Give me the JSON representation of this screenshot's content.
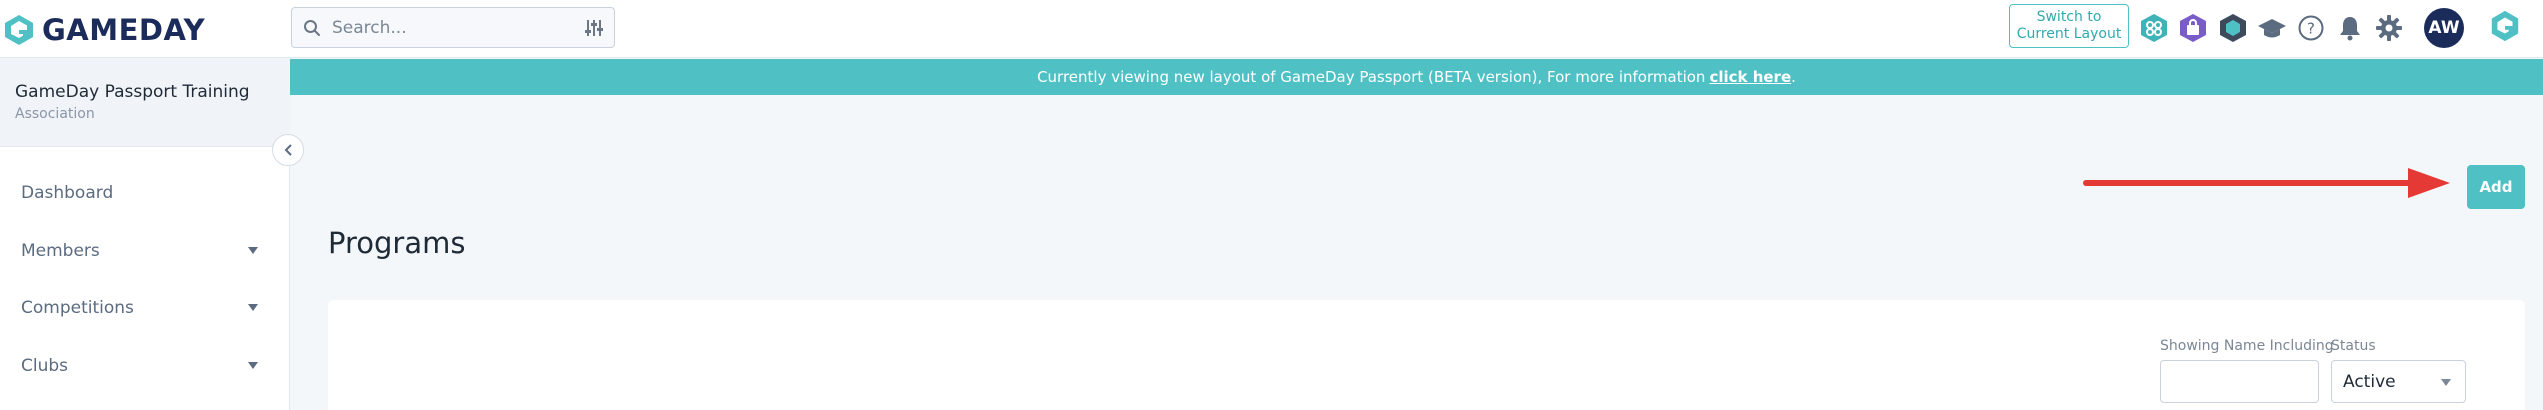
{
  "brand": {
    "name": "GAMEDAY"
  },
  "search": {
    "placeholder": "Search..."
  },
  "header": {
    "switch_line1": "Switch to",
    "switch_line2": "Current Layout",
    "avatar_initials": "AW",
    "icons": [
      "apps-icon",
      "bag-icon",
      "hexagon-icon",
      "graduation-cap-icon",
      "help-icon",
      "bell-icon",
      "gear-icon",
      "gameday-g-icon"
    ]
  },
  "sidebar": {
    "org_name": "GameDay Passport Training",
    "org_type": "Association",
    "items": [
      {
        "label": "Dashboard",
        "has_caret": false
      },
      {
        "label": "Members",
        "has_caret": true
      },
      {
        "label": "Competitions",
        "has_caret": true
      },
      {
        "label": "Clubs",
        "has_caret": true
      }
    ]
  },
  "banner": {
    "text": "Currently viewing new layout of GameDay Passport (BETA version), For more information",
    "link": "click here",
    "suffix": "."
  },
  "main": {
    "add_label": "Add",
    "title": "Programs",
    "filters": {
      "name_label": "Showing Name Including",
      "name_value": "",
      "status_label": "Status",
      "status_value": "Active"
    }
  },
  "colors": {
    "teal": "#4fc1c4",
    "navy": "#1b2c5b",
    "arrow": "#e53935"
  }
}
